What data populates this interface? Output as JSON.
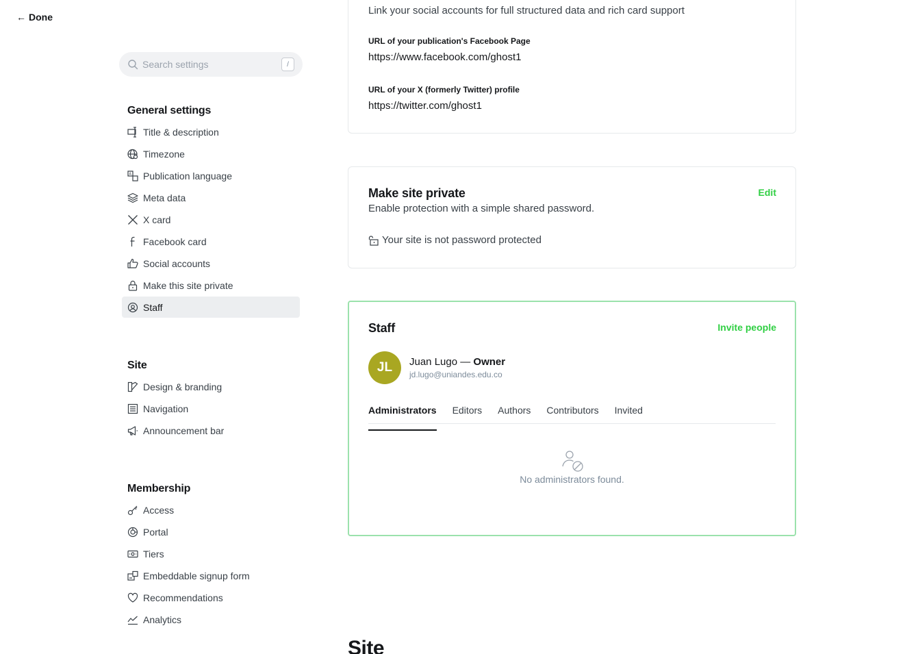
{
  "header": {
    "done_label": "Done"
  },
  "search": {
    "placeholder": "Search settings",
    "shortcut": "/"
  },
  "sidebar": {
    "general": {
      "heading": "General settings",
      "items": [
        {
          "label": "Title & description",
          "icon": "title-icon"
        },
        {
          "label": "Timezone",
          "icon": "globe-icon"
        },
        {
          "label": "Publication language",
          "icon": "language-icon"
        },
        {
          "label": "Meta data",
          "icon": "layers-icon"
        },
        {
          "label": "X card",
          "icon": "x-icon"
        },
        {
          "label": "Facebook card",
          "icon": "facebook-icon"
        },
        {
          "label": "Social accounts",
          "icon": "thumbs-up-icon"
        },
        {
          "label": "Make this site private",
          "icon": "lock-icon"
        },
        {
          "label": "Staff",
          "icon": "staff-icon",
          "active": true
        }
      ]
    },
    "site": {
      "heading": "Site",
      "items": [
        {
          "label": "Design & branding",
          "icon": "brush-icon"
        },
        {
          "label": "Navigation",
          "icon": "navigation-icon"
        },
        {
          "label": "Announcement bar",
          "icon": "megaphone-icon"
        }
      ]
    },
    "membership": {
      "heading": "Membership",
      "items": [
        {
          "label": "Access",
          "icon": "key-icon"
        },
        {
          "label": "Portal",
          "icon": "portal-icon"
        },
        {
          "label": "Tiers",
          "icon": "tiers-icon"
        },
        {
          "label": "Embeddable signup form",
          "icon": "signup-form-icon"
        },
        {
          "label": "Recommendations",
          "icon": "heart-icon"
        },
        {
          "label": "Analytics",
          "icon": "analytics-icon"
        }
      ]
    }
  },
  "social": {
    "description": "Link your social accounts for full structured data and rich card support",
    "facebook_label": "URL of your publication's Facebook Page",
    "facebook_value": "https://www.facebook.com/ghost1",
    "twitter_label": "URL of your X (formerly Twitter) profile",
    "twitter_value": "https://twitter.com/ghost1"
  },
  "private": {
    "title": "Make site private",
    "description": "Enable protection with a simple shared password.",
    "edit_label": "Edit",
    "status": "Your site is not password protected"
  },
  "staff": {
    "title": "Staff",
    "invite_label": "Invite people",
    "owner": {
      "initials": "JL",
      "name": "Juan Lugo",
      "separator": " — ",
      "role": "Owner",
      "email": "jd.lugo@uniandes.edu.co"
    },
    "tabs": [
      "Administrators",
      "Editors",
      "Authors",
      "Contributors",
      "Invited"
    ],
    "empty_message": "No administrators found."
  },
  "next_section": {
    "heading": "Site"
  },
  "colors": {
    "accent_green": "#30cf43",
    "avatar": "#a9a722",
    "active_nav_bg": "#eceef0",
    "staff_border": "#9be2ac"
  }
}
